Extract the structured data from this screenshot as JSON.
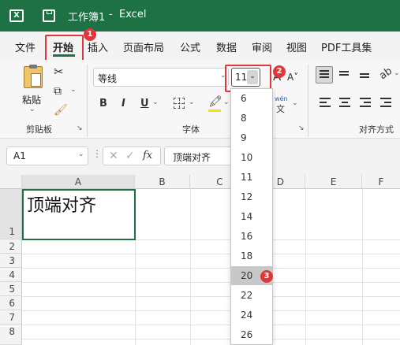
{
  "titlebar": {
    "title": "工作簿1",
    "separator": "-",
    "app": "Excel",
    "app_icon": "excel-icon",
    "save_icon": "save-icon"
  },
  "tabs": [
    "文件",
    "开始",
    "插入",
    "页面布局",
    "公式",
    "数据",
    "审阅",
    "视图",
    "PDF工具集"
  ],
  "ribbon": {
    "paste_label": "粘贴",
    "clipboard_label": "剪贴板",
    "font_name": "等线",
    "font_size": "11",
    "bold": "B",
    "italic": "I",
    "underline": "U",
    "font_group_label": "字体",
    "wen_label": "wén",
    "wen_char": "文",
    "align_label": "对齐方式"
  },
  "formula": {
    "cell_ref": "A1",
    "fx": "fx",
    "value": "顶端对齐"
  },
  "grid": {
    "columns": [
      "A",
      "B",
      "C",
      "D",
      "E",
      "F"
    ],
    "rows": [
      "1",
      "2",
      "3",
      "4",
      "5",
      "6",
      "7",
      "8"
    ],
    "a1_text": "顶端对齐"
  },
  "dropdown": {
    "sizes": [
      "6",
      "8",
      "9",
      "10",
      "11",
      "12",
      "14",
      "16",
      "18",
      "20",
      "22",
      "24",
      "26"
    ],
    "selected": "20"
  },
  "badges": [
    "1",
    "2",
    "3"
  ],
  "colors": {
    "excel_green": "#1e7145",
    "highlight_red": "#e0373a",
    "selected_gray": "#c8c8c8"
  }
}
